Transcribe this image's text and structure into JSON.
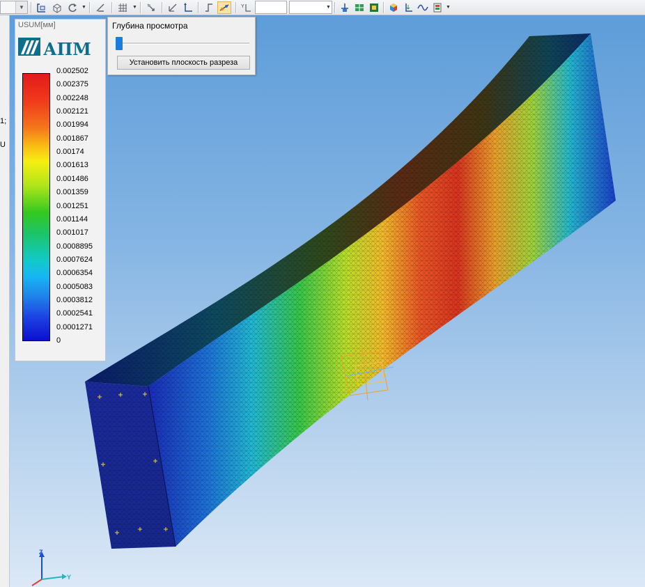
{
  "toolbar": {
    "icons": [
      "select-frame-icon",
      "box-view-icon",
      "rotate-icon",
      "measure-icon",
      "grid-icon",
      "probe-icon",
      "move-axes-icon",
      "corner-icon",
      "section-plane-icon",
      "xy-axis-icon",
      "model-view-icon",
      "mesh-view-icon",
      "solid-view-icon",
      "color-cube-icon",
      "load-icon",
      "wave-icon",
      "layers-icon"
    ],
    "active_tool": "section-plane-icon"
  },
  "left_strip": {
    "text1": "1;",
    "text2": "U"
  },
  "legend": {
    "title": "USUM[мм]",
    "logo_text": "АПМ",
    "labels": [
      "0.002502",
      "0.002375",
      "0.002248",
      "0.002121",
      "0.001994",
      "0.001867",
      "0.00174",
      "0.001613",
      "0.001486",
      "0.001359",
      "0.001251",
      "0.001144",
      "0.001017",
      "0.0008895",
      "0.0007624",
      "0.0006354",
      "0.0005083",
      "0.0003812",
      "0.0002541",
      "0.0001271",
      "0"
    ],
    "colors": {
      "max": "#e31a1a",
      "mid": "#35c81f",
      "min": "#0b0fcf"
    }
  },
  "depth_panel": {
    "title": "Глубина просмотра",
    "button_label": "Установить плоскость разреза",
    "slider_value": 0
  },
  "triad": {
    "z_label": "Z",
    "y_label": "Y"
  }
}
